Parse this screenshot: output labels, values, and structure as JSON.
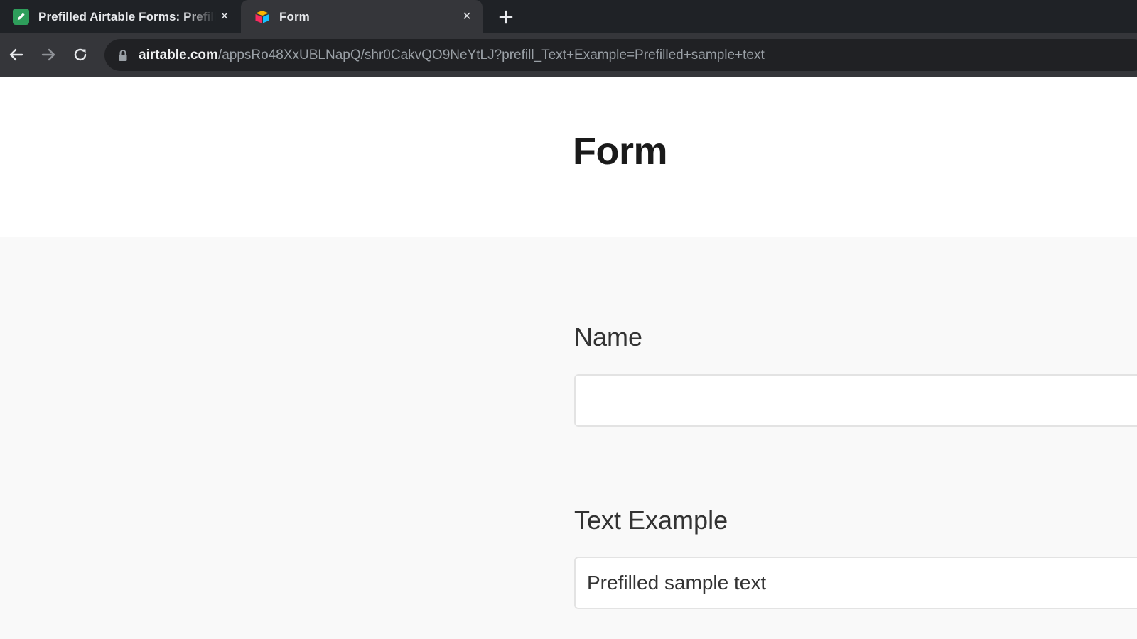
{
  "browser": {
    "tabs": [
      {
        "title": "Prefilled Airtable Forms: Prefill",
        "favicon": "green-pencil-icon",
        "active": false
      },
      {
        "title": "Form",
        "favicon": "airtable-logo-icon",
        "active": true
      }
    ],
    "close_glyph": "×",
    "url": {
      "host": "airtable.com",
      "path": "/appsRo48XxUBLNapQ/shr0CakvQO9NeYtLJ?prefill_Text+Example=Prefilled+sample+text"
    }
  },
  "form": {
    "title": "Form",
    "fields": [
      {
        "label": "Name",
        "value": ""
      },
      {
        "label": "Text Example",
        "value": "Prefilled sample text"
      }
    ]
  },
  "colors": {
    "tab_strip": "#1f2226",
    "toolbar": "#35363a",
    "page_bg": "#f9f9f9",
    "header_bg": "#ffffff"
  }
}
